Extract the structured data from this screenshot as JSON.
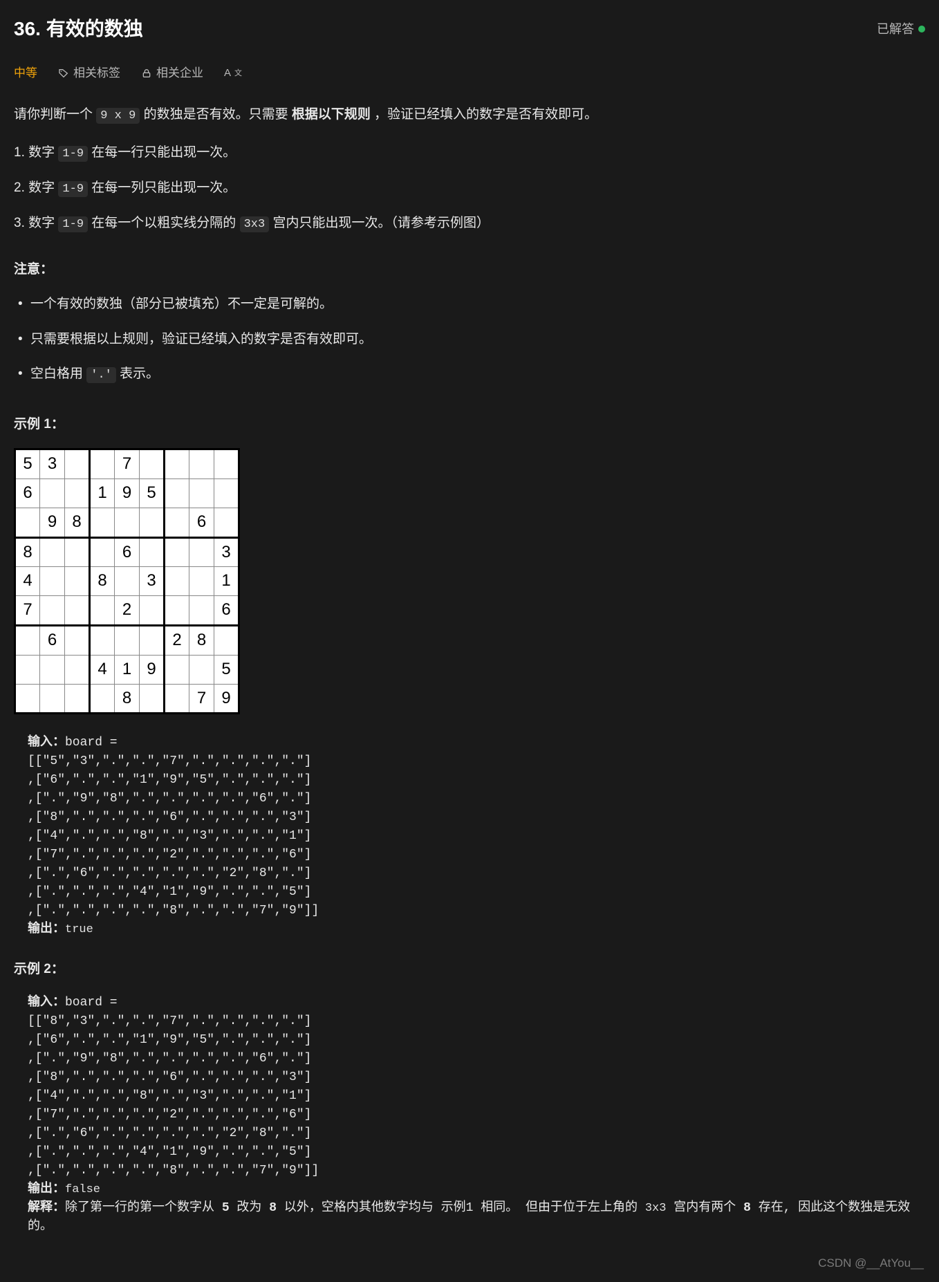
{
  "header": {
    "title": "36. 有效的数独",
    "solved_label": "已解答"
  },
  "meta": {
    "difficulty": "中等",
    "tags_label": "相关标签",
    "companies_label": "相关企业",
    "fontsize_label": "A"
  },
  "description": {
    "line1_prefix": "请你判断一个 ",
    "line1_code": "9 x 9",
    "line1_mid": " 的数独是否有效。只需要 ",
    "line1_bold": "根据以下规则",
    "line1_suffix": " ，验证已经填入的数字是否有效即可。"
  },
  "rules": [
    {
      "idx": "1.",
      "pre": " 数字 ",
      "code": "1-9",
      "post": " 在每一行只能出现一次。"
    },
    {
      "idx": "2.",
      "pre": " 数字 ",
      "code": "1-9",
      "post": " 在每一列只能出现一次。"
    },
    {
      "idx": "3.",
      "pre": " 数字 ",
      "code": "1-9",
      "post": " 在每一个以粗实线分隔的 ",
      "code2": "3x3",
      "post2": " 宫内只能出现一次。（请参考示例图）"
    }
  ],
  "notes_title": "注意：",
  "notes": [
    "一个有效的数独（部分已被填充）不一定是可解的。",
    "只需要根据以上规则，验证已经填入的数字是否有效即可。",
    "空白格用 '.' 表示。"
  ],
  "example1_label": "示例 1：",
  "sudoku": [
    [
      "5",
      "3",
      "",
      "",
      "7",
      "",
      "",
      "",
      ""
    ],
    [
      "6",
      "",
      "",
      "1",
      "9",
      "5",
      "",
      "",
      ""
    ],
    [
      "",
      "9",
      "8",
      "",
      "",
      "",
      "",
      "6",
      ""
    ],
    [
      "8",
      "",
      "",
      "",
      "6",
      "",
      "",
      "",
      "3"
    ],
    [
      "4",
      "",
      "",
      "8",
      "",
      "3",
      "",
      "",
      "1"
    ],
    [
      "7",
      "",
      "",
      "",
      "2",
      "",
      "",
      "",
      "6"
    ],
    [
      "",
      "6",
      "",
      "",
      "",
      "",
      "2",
      "8",
      ""
    ],
    [
      "",
      "",
      "",
      "4",
      "1",
      "9",
      "",
      "",
      "5"
    ],
    [
      "",
      "",
      "",
      "",
      "8",
      "",
      "",
      "7",
      "9"
    ]
  ],
  "io1": {
    "input_label": "输入：",
    "input_prefix": "board = ",
    "board": "[[\"5\",\"3\",\".\",\".\",\"7\",\".\",\".\",\".\",\".\"]\n,[\"6\",\".\",\".\",\"1\",\"9\",\"5\",\".\",\".\",\".\"]\n,[\".\",\"9\",\"8\",\".\",\".\",\".\",\".\",\"6\",\".\"]\n,[\"8\",\".\",\".\",\".\",\"6\",\".\",\".\",\".\",\"3\"]\n,[\"4\",\".\",\".\",\"8\",\".\",\"3\",\".\",\".\",\"1\"]\n,[\"7\",\".\",\".\",\".\",\"2\",\".\",\".\",\".\",\"6\"]\n,[\".\",\"6\",\".\",\".\",\".\",\".\",\"2\",\"8\",\".\"]\n,[\".\",\".\",\".\",\"4\",\"1\",\"9\",\".\",\".\",\"5\"]\n,[\".\",\".\",\".\",\".\",\"8\",\".\",\".\",\"7\",\"9\"]]",
    "output_label": "输出：",
    "output": "true"
  },
  "example2_label": "示例 2：",
  "io2": {
    "input_label": "输入：",
    "input_prefix": "board = ",
    "board": "[[\"8\",\"3\",\".\",\".\",\"7\",\".\",\".\",\".\",\".\"]\n,[\"6\",\".\",\".\",\"1\",\"9\",\"5\",\".\",\".\",\".\"]\n,[\".\",\"9\",\"8\",\".\",\".\",\".\",\".\",\"6\",\".\"]\n,[\"8\",\".\",\".\",\".\",\"6\",\".\",\".\",\".\",\"3\"]\n,[\"4\",\".\",\".\",\"8\",\".\",\"3\",\".\",\".\",\"1\"]\n,[\"7\",\".\",\".\",\".\",\"2\",\".\",\".\",\".\",\"6\"]\n,[\".\",\"6\",\".\",\".\",\".\",\".\",\"2\",\"8\",\".\"]\n,[\".\",\".\",\".\",\"4\",\"1\",\"9\",\".\",\".\",\"5\"]\n,[\".\",\".\",\".\",\".\",\"8\",\".\",\".\",\"7\",\"9\"]]",
    "output_label": "输出：",
    "output": "false",
    "explain_label": "解释：",
    "explain_pre": "除了第一行的第一个数字从 ",
    "explain_b1": "5",
    "explain_mid1": " 改为 ",
    "explain_b2": "8",
    "explain_mid2": " 以外，空格内其他数字均与 示例1 相同。 但由于位于左上角的 ",
    "explain_code": "3x3",
    "explain_mid3": " 宫内有两个 ",
    "explain_b3": "8",
    "explain_suffix": " 存在, 因此这个数独是无效的。"
  },
  "watermark": "CSDN @__AtYou__"
}
